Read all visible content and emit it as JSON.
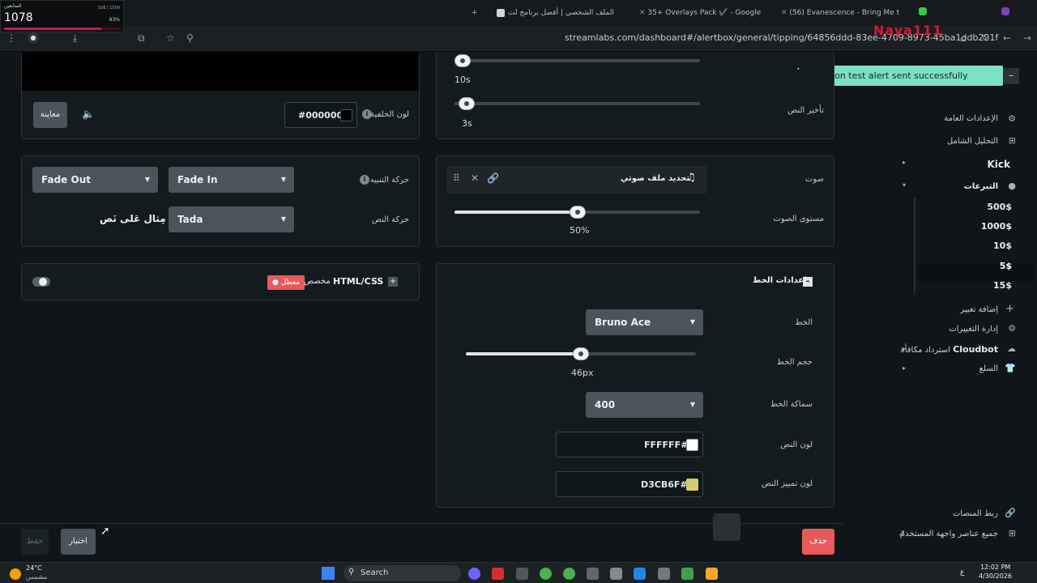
{
  "overlay": {
    "viewers_label": "المتابعين",
    "viewers_count": "1078",
    "ratio": "108 / 1500",
    "percent": "83%",
    "progress": 0.83,
    "watermark": "Naya111"
  },
  "browser": {
    "tabs": [
      {
        "title": "الملف الشخصي | أفضل برنامج لت",
        "x": 0
      },
      {
        "title": "35+ Overlays Pack ✔️ - Google",
        "x": 0
      },
      {
        "title": "(56) Evanescence - Bring Me to",
        "x": 0
      }
    ],
    "new_tab": "+",
    "url": "streamlabs.com/dashboard#/alertbox/general/tipping/64856ddd-83ee-4709-8973-45ba1ddb221f"
  },
  "toast": "Variation test alert sent successfully",
  "preview": {
    "bg_color_label": "لون الخلفية",
    "bg_color_value": "#000000",
    "stop_button": "معاينة",
    "speaker_icon": "speaker-icon"
  },
  "timing": {
    "duration_value": "10s",
    "delay_label": "تأخير النص",
    "delay_value": "3s",
    "duration": 10,
    "delay": 3
  },
  "animation": {
    "alert_anim_label": "حركة التنبيه",
    "text_anim_label": "حركة النص",
    "fade_in": "Fade In",
    "fade_out": "Fade Out",
    "text_anim": "Tada",
    "text_example": "مِثال عَلى نَص"
  },
  "sound": {
    "label": "صوت",
    "choose_file": "تحديد ملف صوتي",
    "volume_label": "مستوى الصوت",
    "volume_value": "50%",
    "volume": 50
  },
  "html_css": {
    "label": "HTML/CSS",
    "custom": "مخصص",
    "badge": "معطل"
  },
  "font": {
    "section_title": "إعدادات الخط",
    "font_label": "الخط",
    "font_value": "Bruno Ace",
    "size_label": "حجم الخط",
    "size_value": "46px",
    "size": 46,
    "weight_label": "سماكة الخط",
    "weight_value": "400",
    "text_color_label": "لون النص",
    "text_color_value": "FFFFFF#",
    "highlight_label": "لون تمييز النص",
    "highlight_value": "D3CB6F#",
    "text_color": "#FFFFFF",
    "highlight_color": "#D3CB6F"
  },
  "sidebar": {
    "general_settings": "الإعدادات العامة",
    "full_analysis": "التحليل الشامل",
    "kick": "Kick",
    "tips": "التبرعات",
    "variations": [
      "500$",
      "1000$",
      "10$",
      "5$",
      "15$"
    ],
    "add_variation": "إضافة تغيير",
    "manage_variations": "إدارة التغييرات",
    "cloudbot": "Cloudbot",
    "cloudbot_reward": "استرداد مكافأة",
    "merch": "السلع",
    "link_platforms": "ربط المنصات",
    "all_widgets": "جميع عناصر واجهة المستخدم"
  },
  "footer": {
    "save": "حفظ",
    "test": "اختبار",
    "delete": "حذف"
  },
  "taskbar": {
    "temp": "24°C",
    "weather": "مشمس",
    "search": "Search",
    "time": "12:02 PM",
    "date": "4/30/2026",
    "lang": "ع"
  }
}
